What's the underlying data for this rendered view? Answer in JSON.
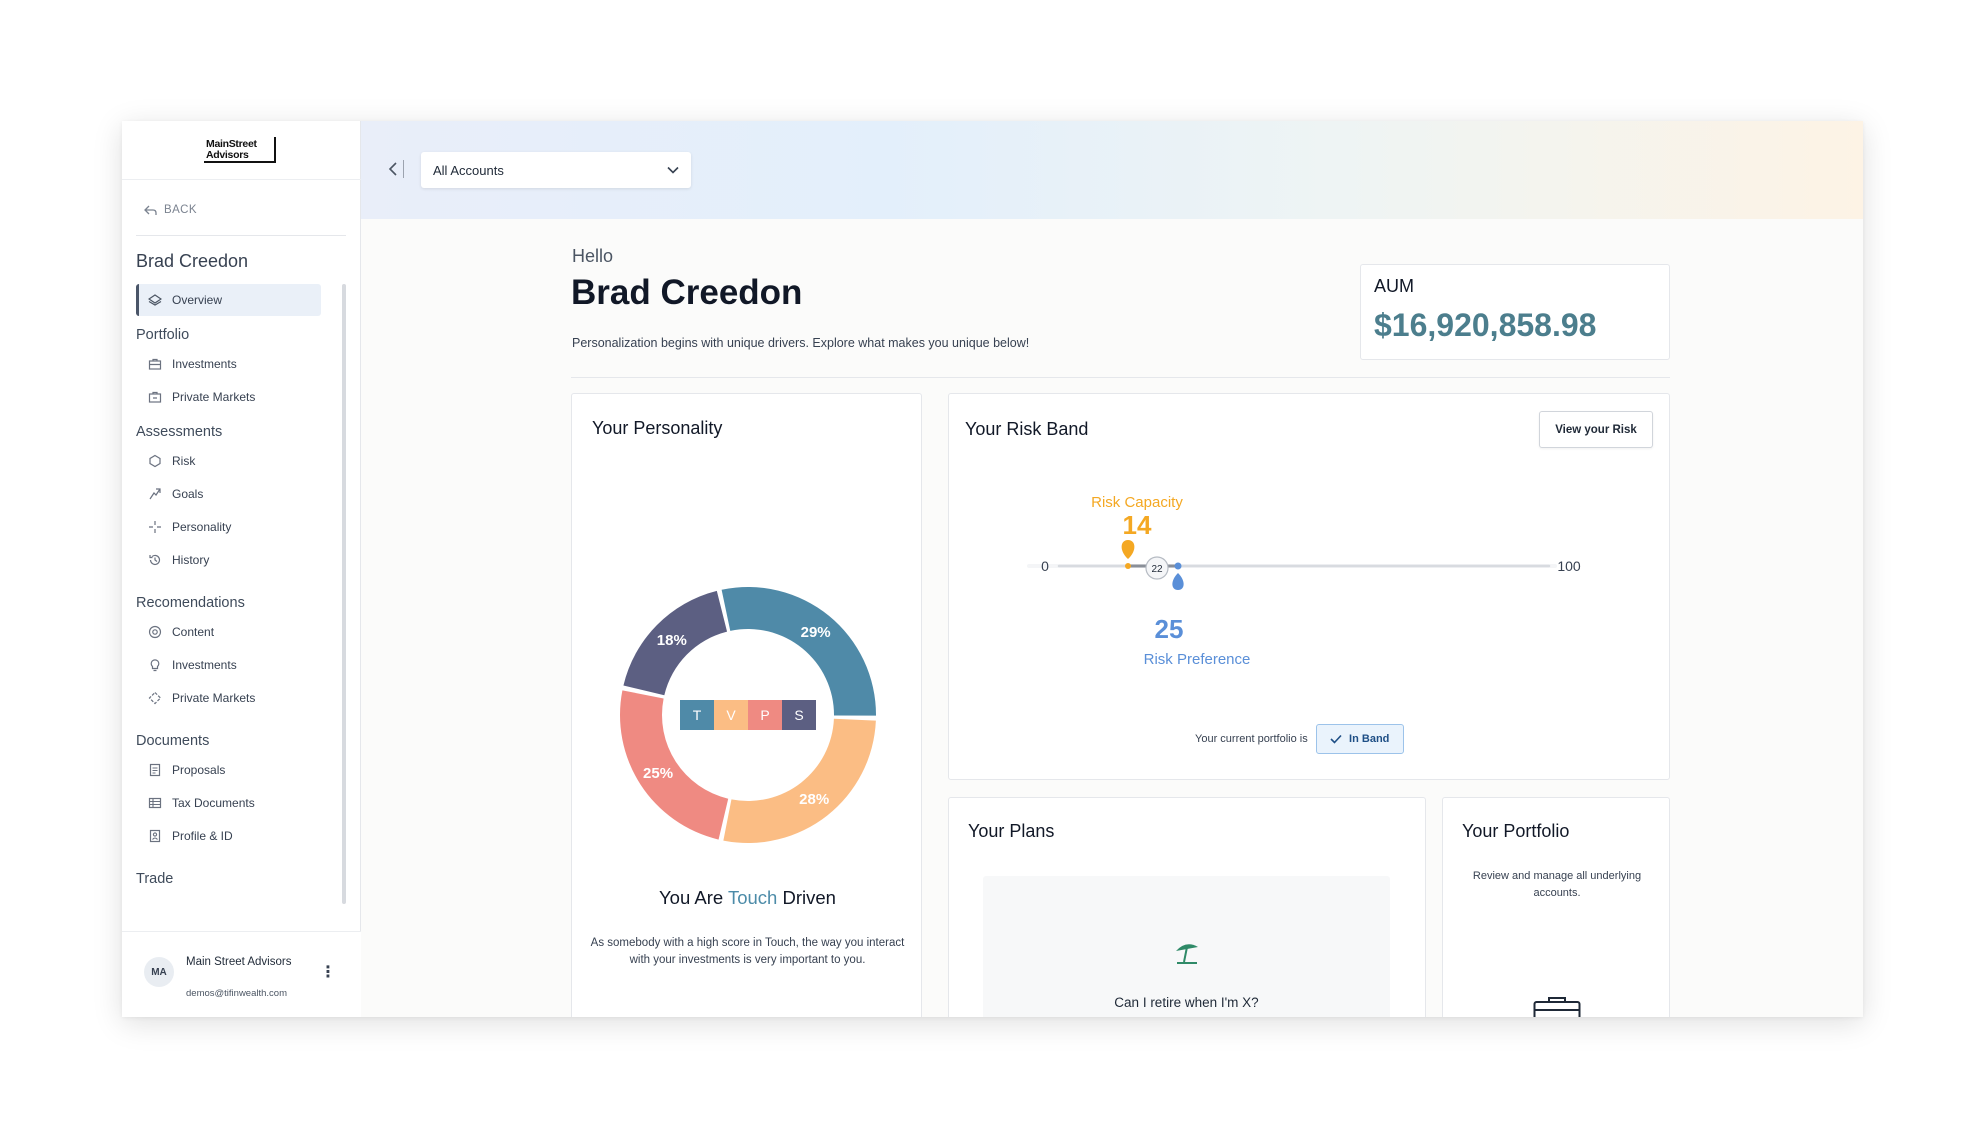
{
  "brand": {
    "line1": "MainStreet",
    "line2": "Advisors"
  },
  "sidebar": {
    "back_label": "BACK",
    "client_name": "Brad Creedon",
    "overview_label": "Overview",
    "sections": {
      "portfolio": "Portfolio",
      "assessments": "Assessments",
      "recommendations": "Recomendations",
      "documents": "Documents",
      "trade": "Trade"
    },
    "portfolio_items": [
      "Investments",
      "Private Markets"
    ],
    "assessment_items": [
      "Risk",
      "Goals",
      "Personality",
      "History"
    ],
    "recommendation_items": [
      "Content",
      "Investments",
      "Private Markets"
    ],
    "document_items": [
      "Proposals",
      "Tax Documents",
      "Profile & ID"
    ]
  },
  "user": {
    "initials": "MA",
    "name": "Main Street Advisors",
    "email": "demos@tifinwealth.com"
  },
  "header": {
    "account_select": "All Accounts"
  },
  "greeting": {
    "hello": "Hello",
    "name": "Brad Creedon",
    "tagline": "Personalization begins with unique drivers. Explore what makes you unique below!"
  },
  "aum": {
    "label": "AUM",
    "value": "$16,920,858.98"
  },
  "personality": {
    "title": "Your Personality",
    "type_prefix": "You Are ",
    "type_name": "Touch",
    "type_suffix": " Driven",
    "description": "As somebody with a high score in Touch, the way you interact with your investments is very important to you.",
    "segments": [
      {
        "letter": "T",
        "percent": 29,
        "label": "29%",
        "color": "#4f8aa8"
      },
      {
        "letter": "V",
        "percent": 28,
        "label": "28%",
        "color": "#fbbd84"
      },
      {
        "letter": "P",
        "percent": 25,
        "label": "25%",
        "color": "#ef8a82"
      },
      {
        "letter": "S",
        "percent": 18,
        "label": "18%",
        "color": "#5c5f82"
      }
    ]
  },
  "risk_band": {
    "title": "Your Risk Band",
    "view_button": "View your Risk",
    "min_label": "0",
    "max_label": "100",
    "capacity_label": "Risk Capacity",
    "capacity_value": 14,
    "capacity_color": "#f4a823",
    "preference_label": "Risk Preference",
    "preference_value": 25,
    "preference_color": "#5a8fd8",
    "current_value": 22,
    "status_prefix": "Your current portfolio is",
    "status_badge": "In Band"
  },
  "plans": {
    "title": "Your Plans",
    "question": "Can I retire when I'm X?"
  },
  "portfolio_card": {
    "title": "Your Portfolio",
    "description": "Review and manage all underlying accounts."
  }
}
